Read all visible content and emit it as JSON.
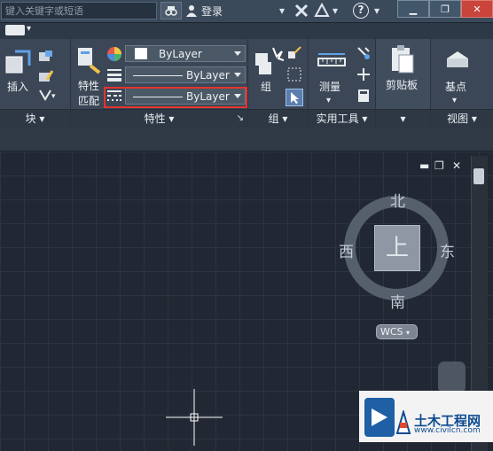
{
  "titlebar": {
    "search_placeholder": "键入关键字或短语",
    "login_label": "登录"
  },
  "ribbon": {
    "panels": {
      "block": {
        "title": "块",
        "insert_label": "插入"
      },
      "properties": {
        "title": "特性",
        "match_label_line1": "特性",
        "match_label_line2": "匹配",
        "color_combo": "ByLayer",
        "lineweight_combo": "ByLayer",
        "linetype_combo": "ByLayer"
      },
      "group": {
        "title": "组",
        "group_label": "组"
      },
      "utilities": {
        "title": "实用工具",
        "measure_label": "测量"
      },
      "clipboard": {
        "title": "",
        "clipboard_label": "剪贴板"
      },
      "view": {
        "title": "视图",
        "base_label": "基点"
      }
    }
  },
  "viewcube": {
    "north": "北",
    "south": "南",
    "east": "东",
    "west": "西",
    "top_face": "上",
    "wcs_label": "WCS"
  },
  "watermark": {
    "title": "土木工程网",
    "url": "www.civilcn.com"
  },
  "colors": {
    "highlight_red": "#e5332e",
    "canvas_bg": "#222833",
    "ribbon_bg": "#3b4756"
  }
}
